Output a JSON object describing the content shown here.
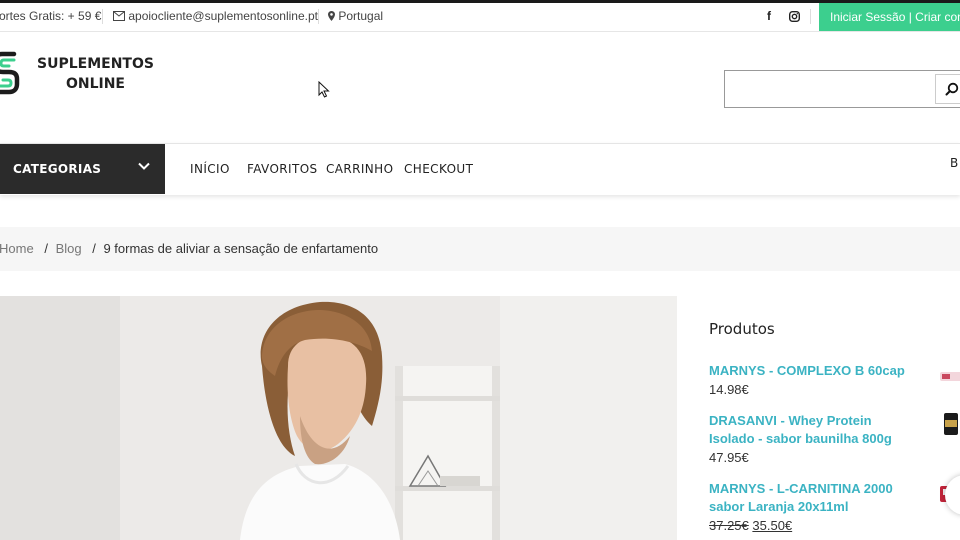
{
  "topbar": {
    "shipping": "ortes Gratis: + 59 €",
    "email": "apoiocliente@suplementosonline.pt",
    "location": "Portugal",
    "facebook_glyph": "f",
    "login": "Iniciar Sessão | Criar conta"
  },
  "brand": {
    "line1": "SUPLEMENTOS",
    "line2": "ONLINE",
    "accent_color": "#3ccf8e"
  },
  "search": {
    "placeholder": ""
  },
  "nav": {
    "categories": "CATEGORIAS",
    "links": [
      "INÍCIO",
      "FAVORITOS",
      "CARRINHO",
      "CHECKOUT"
    ],
    "right_fragment": "B"
  },
  "breadcrumb": {
    "home": "Home",
    "sep": "/",
    "blog": "Blog",
    "current": "9 formas de aliviar a sensação de enfartamento"
  },
  "sidebar": {
    "title": "Produtos",
    "products": [
      {
        "name": "MARNYS - COMPLEXO B 60cap",
        "price": "14.98€"
      },
      {
        "name": "DRASANVI - Whey Protein Isolado - sabor baunilha 800g",
        "price": "47.95€"
      },
      {
        "name": "MARNYS - L-CARNITINA 2000 sabor Laranja 20x11ml",
        "old_price": "37.25€",
        "price": "35.50€"
      }
    ]
  }
}
